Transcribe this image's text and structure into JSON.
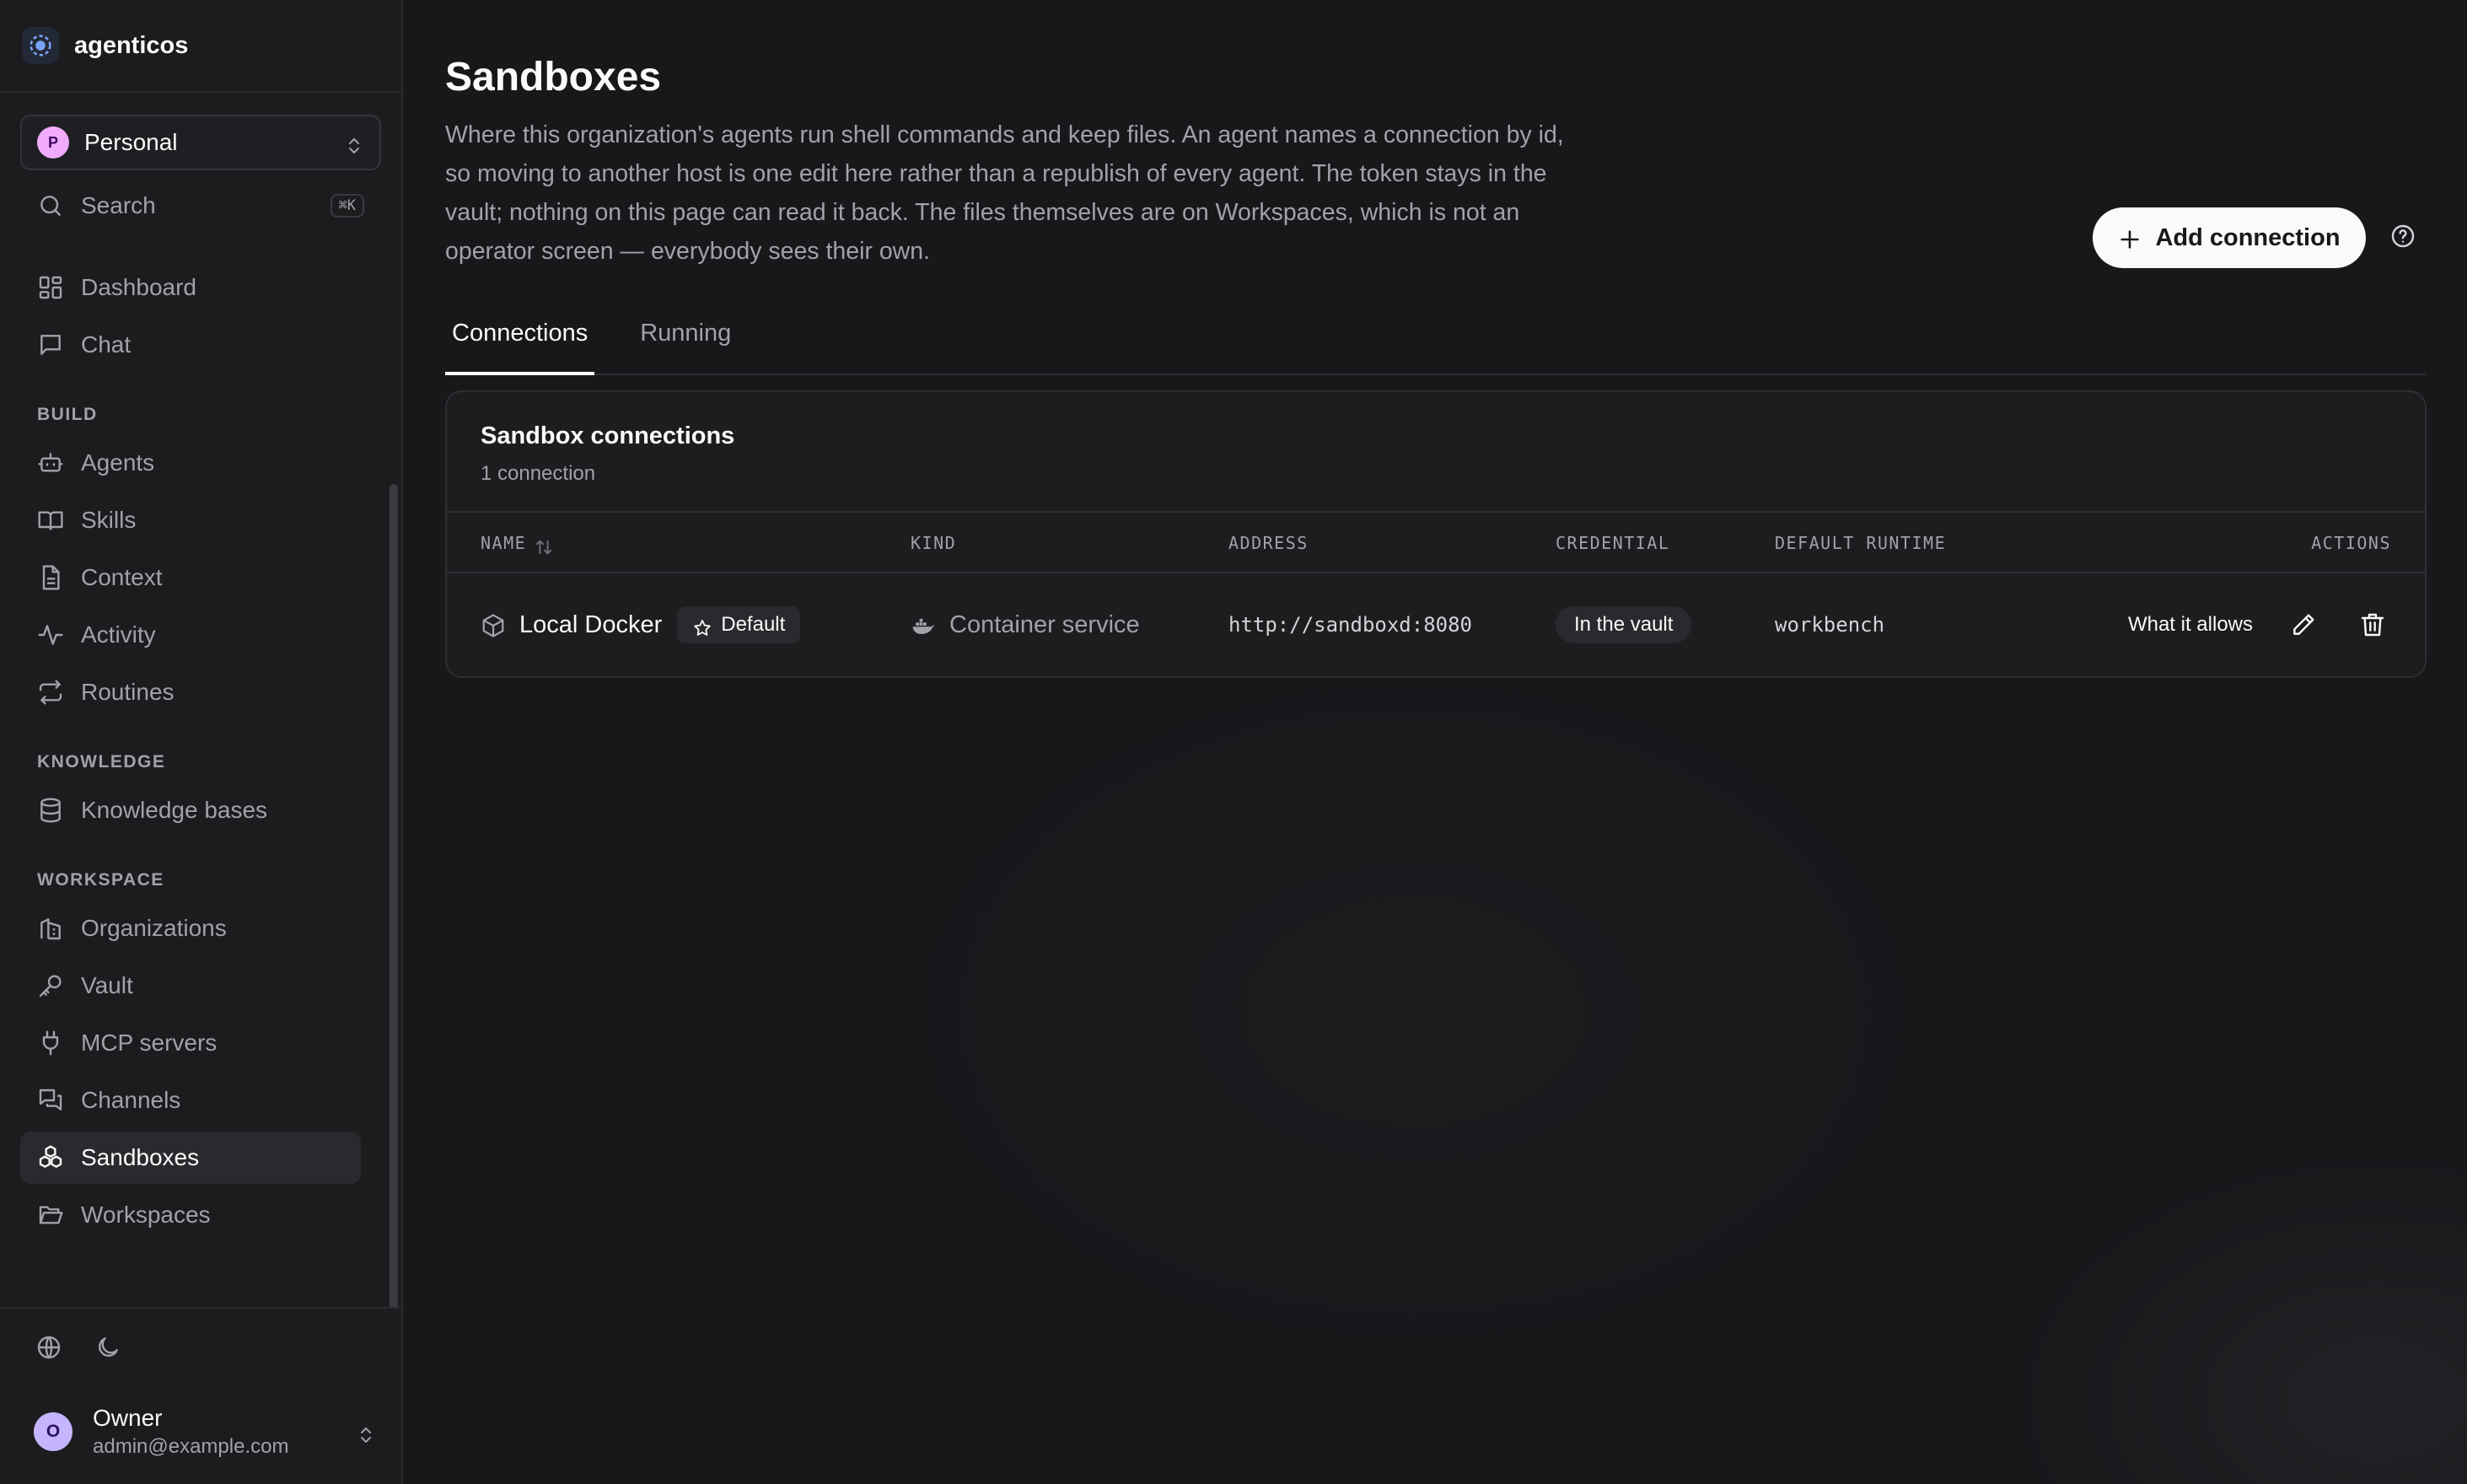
{
  "brand": {
    "name": "agenticos"
  },
  "org_switcher": {
    "avatar_letter": "P",
    "name": "Personal"
  },
  "search": {
    "label": "Search",
    "shortcut": "⌘K"
  },
  "nav": {
    "top": [
      {
        "label": "Dashboard",
        "icon": "dashboard-icon"
      },
      {
        "label": "Chat",
        "icon": "chat-icon"
      }
    ],
    "sections": [
      {
        "title": "BUILD",
        "items": [
          {
            "label": "Agents",
            "icon": "robot-icon"
          },
          {
            "label": "Skills",
            "icon": "book-icon"
          },
          {
            "label": "Context",
            "icon": "document-icon"
          },
          {
            "label": "Activity",
            "icon": "activity-icon"
          },
          {
            "label": "Routines",
            "icon": "repeat-icon"
          }
        ]
      },
      {
        "title": "KNOWLEDGE",
        "items": [
          {
            "label": "Knowledge bases",
            "icon": "database-icon"
          }
        ]
      },
      {
        "title": "WORKSPACE",
        "items": [
          {
            "label": "Organizations",
            "icon": "building-icon"
          },
          {
            "label": "Vault",
            "icon": "key-icon"
          },
          {
            "label": "MCP servers",
            "icon": "plug-icon"
          },
          {
            "label": "Channels",
            "icon": "messages-icon"
          },
          {
            "label": "Sandboxes",
            "icon": "boxes-icon",
            "active": true
          },
          {
            "label": "Workspaces",
            "icon": "folder-open-icon"
          }
        ]
      }
    ]
  },
  "user": {
    "avatar_letter": "O",
    "name": "Owner",
    "email": "admin@example.com"
  },
  "page": {
    "title": "Sandboxes",
    "description": "Where this organization's agents run shell commands and keep files. An agent names a connection by id, so moving to another host is one edit here rather than a republish of every agent. The token stays in the vault; nothing on this page can read it back. The files themselves are on Workspaces, which is not an operator screen — everybody sees their own.",
    "add_button": "Add connection"
  },
  "tabs": [
    {
      "label": "Connections",
      "active": true
    },
    {
      "label": "Running",
      "active": false
    }
  ],
  "card": {
    "title": "Sandbox connections",
    "subtitle": "1 connection",
    "columns": {
      "name": "NAME",
      "kind": "KIND",
      "address": "ADDRESS",
      "credential": "CREDENTIAL",
      "runtime": "DEFAULT RUNTIME",
      "actions": "ACTIONS"
    },
    "rows": [
      {
        "name": "Local Docker",
        "badge": "Default",
        "kind": "Container service",
        "address": "http://sandboxd:8080",
        "credential": "In the vault",
        "runtime": "workbench",
        "action_link": "What it allows"
      }
    ]
  },
  "colors": {
    "accent": "#fafafa",
    "background": "#18181b",
    "sidebar": "#1c1c1f",
    "muted": "#a1a1aa"
  }
}
